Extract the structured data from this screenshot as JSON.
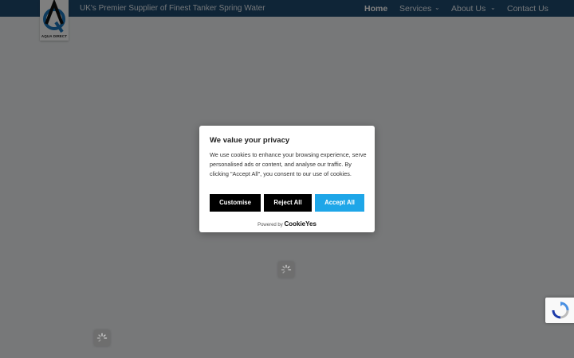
{
  "header": {
    "logo_text": "AQUA DIRECT",
    "tagline": "UK's Premier Supplier of Finest Tanker Spring Water",
    "nav": [
      {
        "label": "Home",
        "active": true,
        "has_dropdown": false
      },
      {
        "label": "Services",
        "active": false,
        "has_dropdown": true
      },
      {
        "label": "About Us",
        "active": false,
        "has_dropdown": true
      },
      {
        "label": "Contact Us",
        "active": false,
        "has_dropdown": false
      }
    ],
    "chevron_glyph": "⌄"
  },
  "cookie_banner": {
    "title": "We value your privacy",
    "body": "We use cookies to enhance your browsing experience, serve personalised ads or content, and analyse our traffic. By clicking \"Accept All\", you consent to our use of cookies.",
    "buttons": {
      "customise": "Customise",
      "reject": "Reject All",
      "accept": "Accept All"
    },
    "powered_by": "Powered by",
    "brand": "CookieYes"
  },
  "colors": {
    "header_bg": "#1f4a6e",
    "accept_button": "#1ea6e8",
    "dark_button": "#000000",
    "overlay": "rgba(0,0,0,0.5)"
  },
  "icons": {
    "logo": "aqua-direct-logo",
    "loader": "spinner-icon",
    "recaptcha": "recaptcha-icon"
  }
}
